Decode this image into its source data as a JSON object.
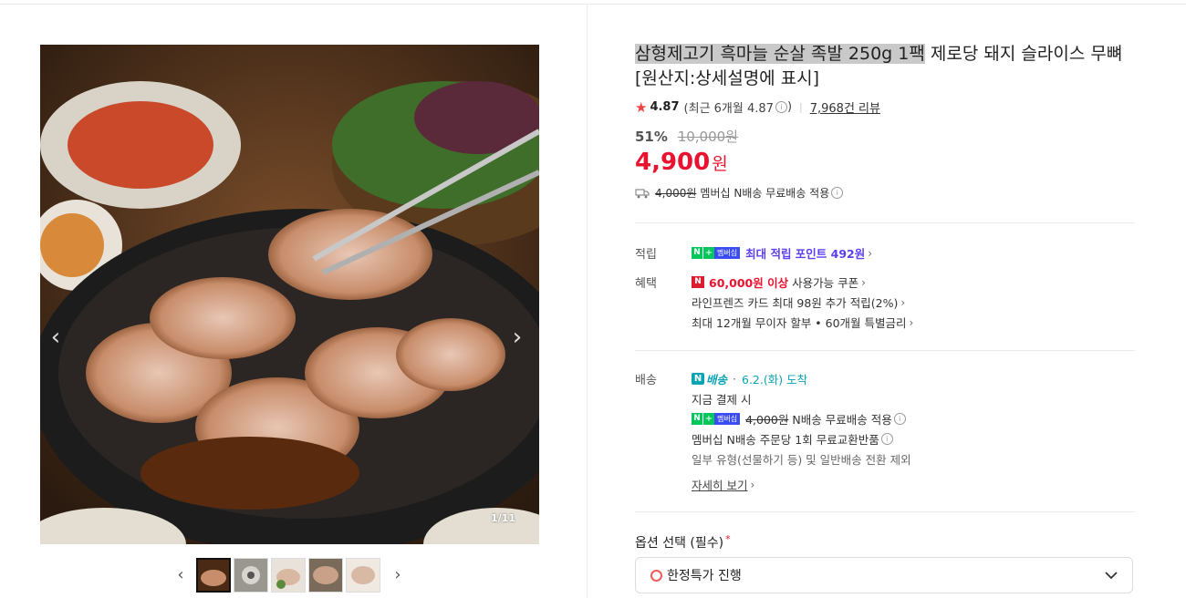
{
  "gallery": {
    "counter": "1/11",
    "prev_icon": "chevron-left-icon",
    "next_icon": "chevron-right-icon",
    "thumbnail_count": 5
  },
  "product": {
    "title_highlight": "삼형제고기 흑마늘 순살 족발 250g 1팩",
    "title_rest": " 제로당 돼지 슬라이스 무뼈 [원산지:상세설명에 표시]",
    "rating": "4.87",
    "recent_rating": "(최근 6개월 4.87",
    "recent_rating_close": ")",
    "reviews": "7,968건 리뷰",
    "discount_pct": "51%",
    "original_price": "10,000원",
    "price": "4,900",
    "price_unit": "원",
    "shipping_strike": "4,000원",
    "shipping_text": "멤버십 N배송 무료배송 적용"
  },
  "points": {
    "label": "적립",
    "text": "최대 적립 포인트 492원"
  },
  "benefits": {
    "label": "혜택",
    "coupon_amount": "60,000원 이상",
    "coupon_text": "사용가능 쿠폰",
    "card_text": "라인프렌즈 카드 최대 98원 추가 적립(2%)",
    "installment_text": "최대 12개월 무이자 할부 • 60개월 특별금리"
  },
  "delivery": {
    "label": "배송",
    "badge": "배송",
    "date": "6.2.(화) 도착",
    "pay_now": "지금 결제 시",
    "member_strike": "4,000원",
    "member_text": "N배송 무료배송 적용",
    "exchange_text": "멤버십 N배송 주문당 1회 무료교환반품",
    "exclusion_text": "일부 유형(선물하기 등) 및 일반배송 전환 제외",
    "details_link": "자세히 보기"
  },
  "options": {
    "label": "옵션 선택 (필수)",
    "required_mark": "*",
    "selected": "한정특가 진행"
  },
  "badges": {
    "npay_n": "N",
    "npay_plus": "+",
    "npay_member": "멤버십",
    "n_red": "N",
    "n_deliv": "N"
  },
  "colors": {
    "price_red": "#e9132f",
    "points_purple": "#5b3ff0",
    "delivery_teal": "#0aa4b4",
    "npay_green": "#03c75a"
  }
}
